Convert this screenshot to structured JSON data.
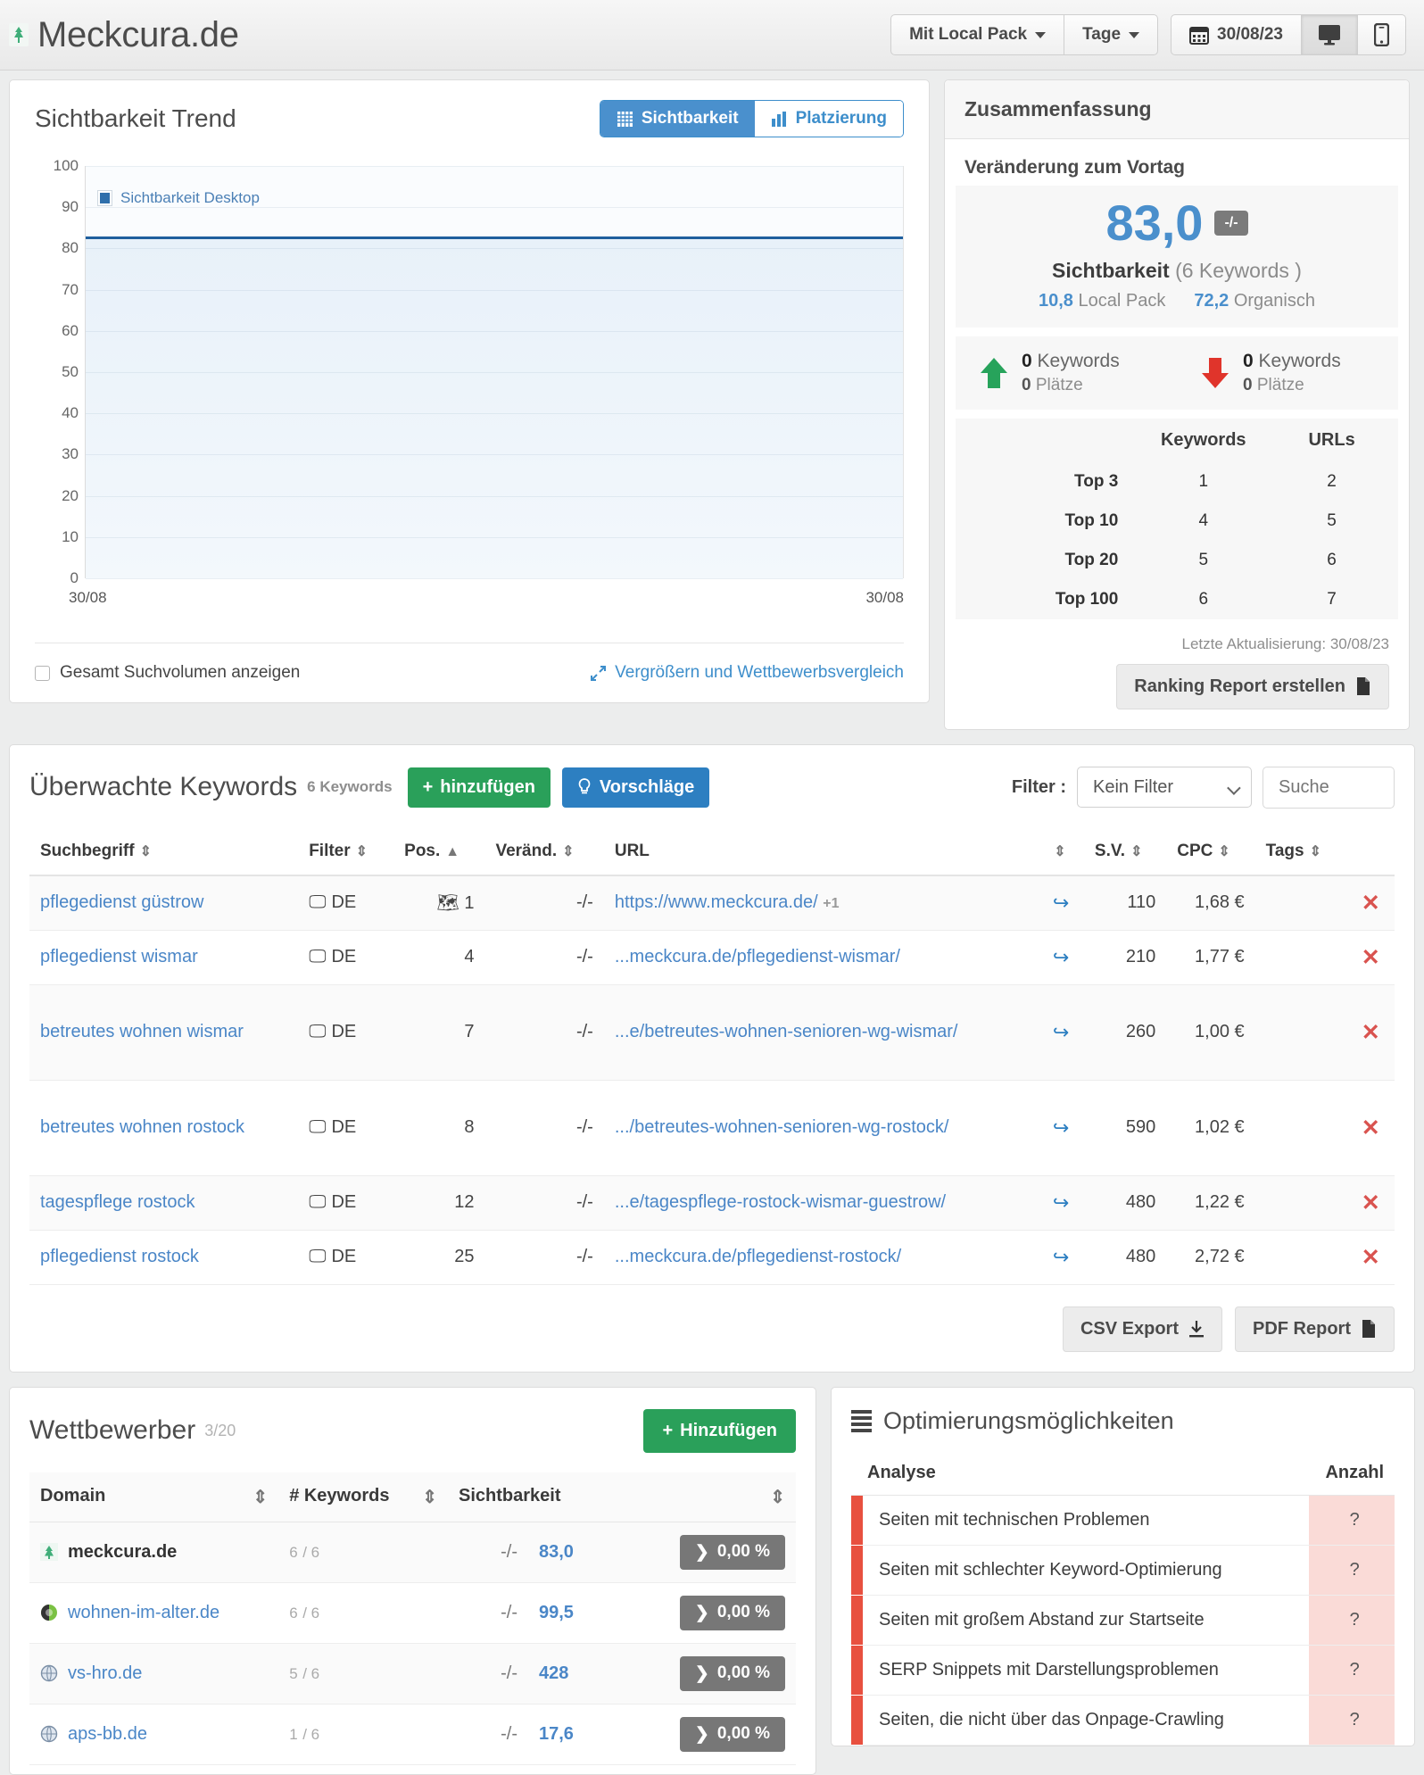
{
  "header": {
    "site_title": "Meckcura.de",
    "favicon_name": "tree-icon",
    "local_pack_label": "Mit Local Pack",
    "interval_label": "Tage",
    "date_label": "30/08/23",
    "desktop_icon": "desktop-icon",
    "mobile_icon": "mobile-icon"
  },
  "chart_panel": {
    "title": "Sichtbarkeit Trend",
    "toggle": {
      "visibility_label": "Sichtbarkeit",
      "ranking_label": "Platzierung",
      "active": "Sichtbarkeit"
    },
    "checkbox_label": "Gesamt Suchvolumen anzeigen",
    "zoom_link": "Vergrößern und Wettbewerbsvergleich"
  },
  "chart_data": {
    "type": "line",
    "title": "Sichtbarkeit Trend",
    "series": [
      {
        "name": "Sichtbarkeit Desktop",
        "values": [
          83.0,
          83.0
        ],
        "color": "#1f5f9e"
      }
    ],
    "x": [
      "30/08",
      "30/08"
    ],
    "xlabel": "",
    "ylabel": "",
    "ylim": [
      0,
      100
    ],
    "yticks": [
      0,
      10,
      20,
      30,
      40,
      50,
      60,
      70,
      80,
      90,
      100
    ],
    "grid": true,
    "legend": [
      "Sichtbarkeit Desktop"
    ],
    "legend_position": "top-left"
  },
  "summary": {
    "heading": "Zusammenfassung",
    "subheading": "Veränderung zum Vortag",
    "visibility_value": "83,0",
    "change_badge": "-/-",
    "visibility_label": "Sichtbarkeit",
    "visibility_keywords": "(6 Keywords )",
    "local_pack_value": "10,8",
    "local_pack_label": "Local Pack",
    "organic_value": "72,2",
    "organic_label": "Organisch",
    "up": {
      "keywords_value": "0",
      "keywords_label": "Keywords",
      "places_value": "0",
      "places_label": "Plätze"
    },
    "down": {
      "keywords_value": "0",
      "keywords_label": "Keywords",
      "places_value": "0",
      "places_label": "Plätze"
    },
    "rank_table": {
      "col_keywords": "Keywords",
      "col_urls": "URLs",
      "rows": [
        {
          "label": "Top 3",
          "keywords": "1",
          "urls": "2"
        },
        {
          "label": "Top 10",
          "keywords": "4",
          "urls": "5"
        },
        {
          "label": "Top 20",
          "keywords": "5",
          "urls": "6"
        },
        {
          "label": "Top 100",
          "keywords": "6",
          "urls": "7"
        }
      ]
    },
    "last_update": "Letzte Aktualisierung: 30/08/23",
    "report_button": "Ranking Report erstellen"
  },
  "keywords": {
    "title": "Überwachte Keywords",
    "count_label": "6 Keywords",
    "add_button": "hinzufügen",
    "suggestions_button": "Vorschläge",
    "filter_label": "Filter :",
    "filter_value": "Kein Filter",
    "filter_options": [
      "Kein Filter"
    ],
    "search_placeholder": "Suche",
    "columns": {
      "term": "Suchbegriff",
      "filter": "Filter",
      "pos": "Pos.",
      "change": "Veränd.",
      "url": "URL",
      "sv": "S.V.",
      "cpc": "CPC",
      "tags": "Tags"
    },
    "sort_indicator": "▲",
    "rows": [
      {
        "term": "pflegedienst güstrow",
        "device": "desktop-icon",
        "country": "DE",
        "pos": "1",
        "pos_icon": "map-marker-icon",
        "change": "-/-",
        "url": "https://www.meckcura.de/",
        "url_extra": "+1",
        "sv": "110",
        "cpc": "1,68 €",
        "tags": ""
      },
      {
        "term": "pflegedienst wismar",
        "device": "desktop-icon",
        "country": "DE",
        "pos": "4",
        "pos_icon": "",
        "change": "-/-",
        "url": "...meckcura.de/pflegedienst-wismar/",
        "url_extra": "",
        "sv": "210",
        "cpc": "1,77 €",
        "tags": ""
      },
      {
        "term": "betreutes wohnen wismar",
        "device": "desktop-icon",
        "country": "DE",
        "pos": "7",
        "pos_icon": "",
        "change": "-/-",
        "url": "...e/betreutes-wohnen-senioren-wg-wismar/",
        "url_extra": "",
        "sv": "260",
        "cpc": "1,00 €",
        "tags": ""
      },
      {
        "term": "betreutes wohnen rostock",
        "device": "desktop-icon",
        "country": "DE",
        "pos": "8",
        "pos_icon": "",
        "change": "-/-",
        "url": ".../betreutes-wohnen-senioren-wg-rostock/",
        "url_extra": "",
        "sv": "590",
        "cpc": "1,02 €",
        "tags": ""
      },
      {
        "term": "tagespflege rostock",
        "device": "desktop-icon",
        "country": "DE",
        "pos": "12",
        "pos_icon": "",
        "change": "-/-",
        "url": "...e/tagespflege-rostock-wismar-guestrow/",
        "url_extra": "",
        "sv": "480",
        "cpc": "1,22 €",
        "tags": ""
      },
      {
        "term": "pflegedienst rostock",
        "device": "desktop-icon",
        "country": "DE",
        "pos": "25",
        "pos_icon": "",
        "change": "-/-",
        "url": "...meckcura.de/pflegedienst-rostock/",
        "url_extra": "",
        "sv": "480",
        "cpc": "2,72 €",
        "tags": ""
      }
    ],
    "csv_button": "CSV Export",
    "pdf_button": "PDF Report"
  },
  "competitors": {
    "title": "Wettbewerber",
    "count_current": "3",
    "count_max": "/20",
    "add_button": "Hinzufügen",
    "columns": {
      "domain": "Domain",
      "keywords": "# Keywords",
      "visibility": "Sichtbarkeit"
    },
    "rows": [
      {
        "domain": "meckcura.de",
        "is_self": true,
        "icon": "tree-favicon",
        "keywords": "6",
        "keywords_total": "/ 6",
        "change": "-/-",
        "visibility": "83,0",
        "pct": "0,00 %"
      },
      {
        "domain": "wohnen-im-alter.de",
        "is_self": false,
        "icon": "globe-green-favicon",
        "keywords": "6",
        "keywords_total": "/ 6",
        "change": "-/-",
        "visibility": "99,5",
        "pct": "0,00 %"
      },
      {
        "domain": "vs-hro.de",
        "is_self": false,
        "icon": "globe-favicon",
        "keywords": "5",
        "keywords_total": "/ 6",
        "change": "-/-",
        "visibility": "428",
        "pct": "0,00 %"
      },
      {
        "domain": "aps-bb.de",
        "is_self": false,
        "icon": "globe-favicon",
        "keywords": "1",
        "keywords_total": "/ 6",
        "change": "-/-",
        "visibility": "17,6",
        "pct": "0,00 %"
      }
    ]
  },
  "optimization": {
    "title": "Optimierungsmöglichkeiten",
    "columns": {
      "analysis": "Analyse",
      "count": "Anzahl"
    },
    "rows": [
      {
        "label": "Seiten mit technischen Problemen",
        "count": "?"
      },
      {
        "label": "Seiten mit schlechter Keyword-Optimierung",
        "count": "?"
      },
      {
        "label": "Seiten mit großem Abstand zur Startseite",
        "count": "?"
      },
      {
        "label": "SERP Snippets mit Darstellungsproblemen",
        "count": "?"
      },
      {
        "label": "Seiten, die nicht über das Onpage-Crawling",
        "count": "?"
      }
    ]
  }
}
